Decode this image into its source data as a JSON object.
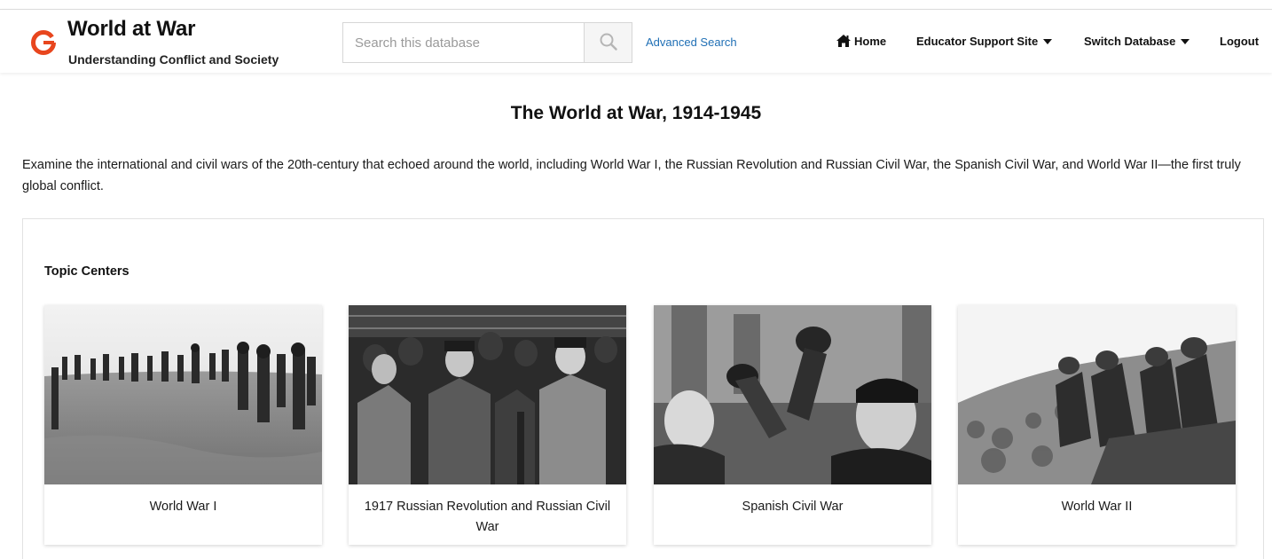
{
  "header": {
    "title": "World at War",
    "subtitle": "Understanding Conflict and Society",
    "logo_icon": "gale-logo-icon",
    "accent_color": "#e8461e",
    "search": {
      "placeholder": "Search this database",
      "value": "",
      "icon": "search-icon"
    },
    "advanced_search": "Advanced Search",
    "nav": {
      "home": "Home",
      "home_icon": "home-icon",
      "educator": "Educator Support Site",
      "switch": "Switch Database",
      "logout": "Logout"
    }
  },
  "main": {
    "title": "The World at War, 1914-1945",
    "intro": "Examine the international and civil wars of the 20th-century that echoed around the world, including World War I, the Russian Revolution and Russian Civil War, the Spanish Civil War, and World War II—the first truly global conflict.",
    "topic_centers": {
      "heading": "Topic Centers",
      "cards": [
        {
          "label": "World War I",
          "image": "ww1-soldiers-charging-photo"
        },
        {
          "label": "1917 Russian Revolution and Russian Civil War",
          "image": "russian-revolution-crowd-photo"
        },
        {
          "label": "Spanish Civil War",
          "image": "spanish-civil-war-raised-fists-photo"
        },
        {
          "label": "World War II",
          "image": "ww2-soldiers-on-rubble-photo"
        }
      ]
    }
  }
}
